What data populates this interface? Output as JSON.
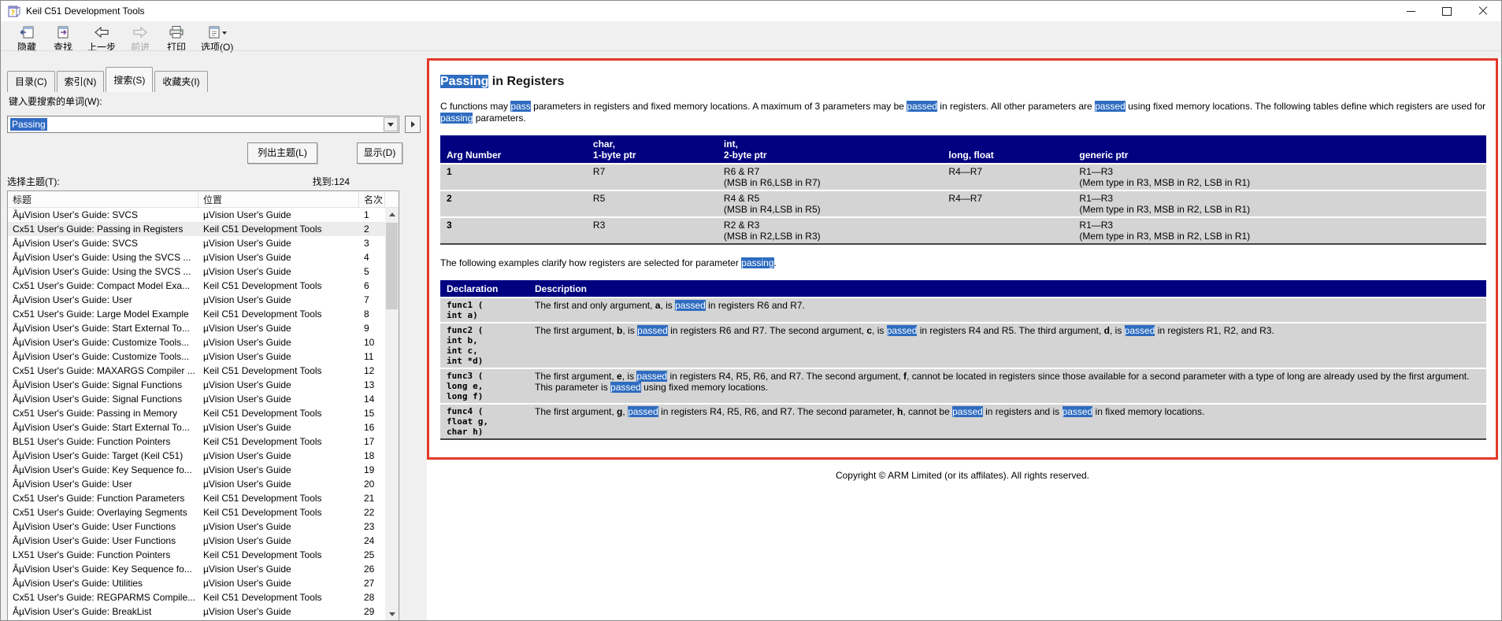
{
  "window": {
    "title": "Keil C51 Development Tools",
    "icons": {
      "app": "help-book-icon",
      "minimize": "minimize-icon",
      "maximize": "maximize-icon",
      "close": "close-icon"
    }
  },
  "toolbar": {
    "buttons": [
      {
        "label": "隐藏",
        "icon": "hide-icon",
        "disabled": false
      },
      {
        "label": "查找",
        "icon": "locate-icon",
        "disabled": false
      },
      {
        "label": "上一步",
        "icon": "back-icon",
        "disabled": false
      },
      {
        "label": "前进",
        "icon": "forward-icon",
        "disabled": true
      },
      {
        "label": "打印",
        "icon": "print-icon",
        "disabled": false
      },
      {
        "label": "选项(O)",
        "icon": "options-icon",
        "disabled": false
      }
    ]
  },
  "sidebar": {
    "tabs": [
      {
        "label": "目录(C)",
        "active": false
      },
      {
        "label": "索引(N)",
        "active": false
      },
      {
        "label": "搜索(S)",
        "active": true
      },
      {
        "label": "收藏夹(I)",
        "active": false
      }
    ],
    "search_label": "键入要搜索的单词(W):",
    "search_value": "Passing",
    "list_topics_button": "列出主题(L)",
    "display_button": "显示(D)",
    "select_topic_label": "选择主题(T):",
    "found_label": "找到:124",
    "results": {
      "columns": [
        "标题",
        "位置",
        "名次"
      ],
      "selected_index": 1,
      "rows": [
        [
          "ÂµVision User's Guide: SVCS",
          "µVision User's Guide",
          "1"
        ],
        [
          "Cx51 User's Guide: Passing in Registers",
          "Keil C51 Development Tools",
          "2"
        ],
        [
          "ÂµVision User's Guide: SVCS",
          "µVision User's Guide",
          "3"
        ],
        [
          "ÂµVision User's Guide: Using the SVCS ...",
          "µVision User's Guide",
          "4"
        ],
        [
          "ÂµVision User's Guide: Using the SVCS ...",
          "µVision User's Guide",
          "5"
        ],
        [
          "Cx51 User's Guide: Compact Model Exa...",
          "Keil C51 Development Tools",
          "6"
        ],
        [
          "ÂµVision User's Guide: User",
          "µVision User's Guide",
          "7"
        ],
        [
          "Cx51 User's Guide: Large Model Example",
          "Keil C51 Development Tools",
          "8"
        ],
        [
          "ÂµVision User's Guide: Start External To...",
          "µVision User's Guide",
          "9"
        ],
        [
          "ÂµVision User's Guide: Customize Tools...",
          "µVision User's Guide",
          "10"
        ],
        [
          "ÂµVision User's Guide: Customize Tools...",
          "µVision User's Guide",
          "11"
        ],
        [
          "Cx51 User's Guide: MAXARGS Compiler ...",
          "Keil C51 Development Tools",
          "12"
        ],
        [
          "ÂµVision User's Guide: Signal Functions",
          "µVision User's Guide",
          "13"
        ],
        [
          "ÂµVision User's Guide: Signal Functions",
          "µVision User's Guide",
          "14"
        ],
        [
          "Cx51 User's Guide: Passing in Memory",
          "Keil C51 Development Tools",
          "15"
        ],
        [
          "ÂµVision User's Guide: Start External To...",
          "µVision User's Guide",
          "16"
        ],
        [
          "BL51 User's Guide: Function Pointers",
          "Keil C51 Development Tools",
          "17"
        ],
        [
          "ÂµVision User's Guide: Target (Keil C51)",
          "µVision User's Guide",
          "18"
        ],
        [
          "ÂµVision User's Guide: Key Sequence fo...",
          "µVision User's Guide",
          "19"
        ],
        [
          "ÂµVision User's Guide: User",
          "µVision User's Guide",
          "20"
        ],
        [
          "Cx51 User's Guide: Function Parameters",
          "Keil C51 Development Tools",
          "21"
        ],
        [
          "Cx51 User's Guide: Overlaying Segments",
          "Keil C51 Development Tools",
          "22"
        ],
        [
          "ÂµVision User's Guide: User Functions",
          "µVision User's Guide",
          "23"
        ],
        [
          "ÂµVision User's Guide: User Functions",
          "µVision User's Guide",
          "24"
        ],
        [
          "LX51 User's Guide: Function Pointers",
          "Keil C51 Development Tools",
          "25"
        ],
        [
          "ÂµVision User's Guide: Key Sequence fo...",
          "µVision User's Guide",
          "26"
        ],
        [
          "ÂµVision User's Guide: Utilities",
          "µVision User's Guide",
          "27"
        ],
        [
          "Cx51 User's Guide: REGPARMS Compile...",
          "Keil C51 Development Tools",
          "28"
        ],
        [
          "ÂµVision User's Guide: BreakList",
          "µVision User's Guide",
          "29"
        ]
      ]
    }
  },
  "content": {
    "accent_colors": {
      "highlight": "#2e6cc0",
      "table_header": "#000080",
      "annotation_border": "#e23a28"
    },
    "heading_segments": [
      {
        "t": "Passing",
        "m": "h"
      },
      {
        "t": " in Registers"
      }
    ],
    "para1_segments": [
      {
        "t": "C functions may "
      },
      {
        "t": "pass",
        "m": "h"
      },
      {
        "t": " parameters in registers and fixed memory locations. A maximum of 3 parameters may be "
      },
      {
        "t": "passed",
        "m": "h"
      },
      {
        "t": " in registers. All other parameters are "
      },
      {
        "t": "passed",
        "m": "h"
      },
      {
        "t": " using fixed memory locations. The following tables define which registers are used for "
      },
      {
        "t": "passing",
        "m": "h"
      },
      {
        "t": " parameters."
      }
    ],
    "table1": {
      "headers": [
        "Arg Number",
        "char,\n1-byte ptr",
        "int,\n2-byte ptr",
        "long, float",
        "generic ptr"
      ],
      "rows": [
        [
          "1",
          "R7",
          "R6 & R7\n(MSB in R6,LSB in R7)",
          "R4—R7",
          "R1—R3\n(Mem type in R3, MSB in R2, LSB in R1)"
        ],
        [
          "2",
          "R5",
          "R4 & R5\n(MSB in R4,LSB in R5)",
          "R4—R7",
          "R1—R3\n(Mem type in R3, MSB in R2, LSB in R1)"
        ],
        [
          "3",
          "R3",
          "R2 & R3\n(MSB in R2,LSB in R3)",
          "",
          "R1—R3\n(Mem type in R3, MSB in R2, LSB in R1)"
        ]
      ]
    },
    "para2_segments": [
      {
        "t": "The following examples clarify how registers are selected for parameter "
      },
      {
        "t": "passing",
        "m": "h"
      },
      {
        "t": "."
      }
    ],
    "table2": {
      "headers": [
        "Declaration",
        "Description"
      ],
      "rows": [
        [
          "func1 (\nint a)",
          [
            {
              "t": "The first and only argument, "
            },
            {
              "t": "a",
              "m": "b"
            },
            {
              "t": ", is "
            },
            {
              "t": "passed",
              "m": "h"
            },
            {
              "t": " in registers R6 and R7."
            }
          ]
        ],
        [
          "func2 (\nint b,\nint c,\nint *d)",
          [
            {
              "t": "The first argument, "
            },
            {
              "t": "b",
              "m": "b"
            },
            {
              "t": ", is "
            },
            {
              "t": "passed",
              "m": "h"
            },
            {
              "t": " in registers R6 and R7. The second argument, "
            },
            {
              "t": "c",
              "m": "b"
            },
            {
              "t": ", is "
            },
            {
              "t": "passed",
              "m": "h"
            },
            {
              "t": " in registers R4 and R5. The third argument, "
            },
            {
              "t": "d",
              "m": "b"
            },
            {
              "t": ", is "
            },
            {
              "t": "passed",
              "m": "h"
            },
            {
              "t": " in registers R1, R2, and R3."
            }
          ]
        ],
        [
          "func3 (\nlong e,\nlong f)",
          [
            {
              "t": "The first argument, "
            },
            {
              "t": "e",
              "m": "b"
            },
            {
              "t": ", is "
            },
            {
              "t": "passed",
              "m": "h"
            },
            {
              "t": " in registers R4, R5, R6, and R7. The second argument, "
            },
            {
              "t": "f",
              "m": "b"
            },
            {
              "t": ", cannot be located in registers since those available for a second parameter with a type of long are already used by the first argument. This parameter is "
            },
            {
              "t": "passed",
              "m": "h"
            },
            {
              "t": " using fixed memory locations."
            }
          ]
        ],
        [
          "func4 (\nfloat g,\nchar h)",
          [
            {
              "t": "The first argument, "
            },
            {
              "t": "g",
              "m": "b"
            },
            {
              "t": ", "
            },
            {
              "t": "passed",
              "m": "h"
            },
            {
              "t": " in registers R4, R5, R6, and R7. The second parameter, "
            },
            {
              "t": "h",
              "m": "b"
            },
            {
              "t": ", cannot be "
            },
            {
              "t": "passed",
              "m": "h"
            },
            {
              "t": " in registers and is "
            },
            {
              "t": "passed",
              "m": "h"
            },
            {
              "t": " in fixed memory locations."
            }
          ]
        ]
      ]
    },
    "copyright": "Copyright © ARM Limited (or its affilates). All rights reserved."
  }
}
